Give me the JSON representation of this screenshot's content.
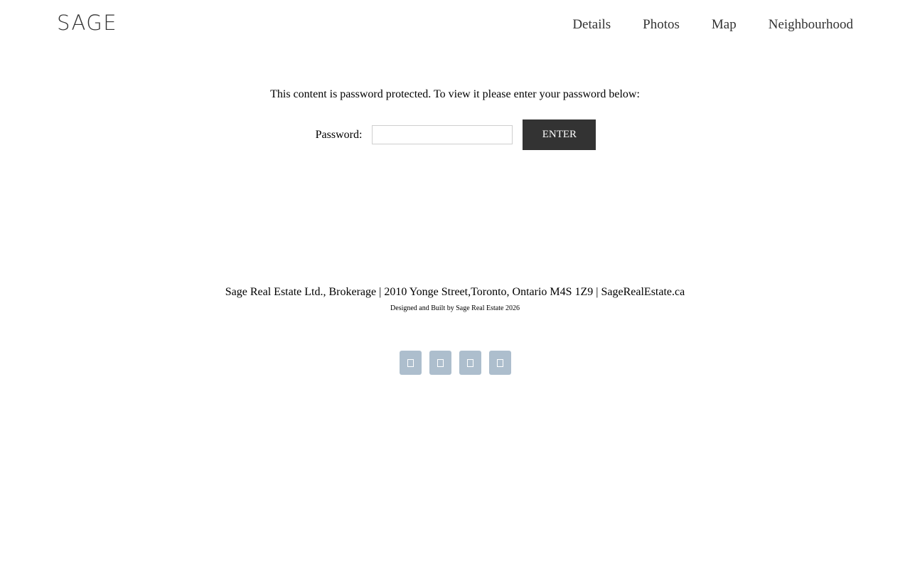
{
  "header": {
    "logo": "SAGE",
    "nav": [
      {
        "label": "Details"
      },
      {
        "label": "Photos"
      },
      {
        "label": "Map"
      },
      {
        "label": "Neighbourhood"
      }
    ]
  },
  "protected": {
    "message": "This content is password protected. To view it please enter your password below:",
    "password_label": "Password:",
    "password_value": "",
    "enter_label": "ENTER"
  },
  "footer": {
    "address": "Sage Real Estate Ltd., Brokerage | 2010 Yonge Street,Toronto, Ontario M4S 1Z9 | SageRealEstate.ca",
    "credit": "Designed and Built by Sage Real Estate 2026",
    "social": [
      {
        "icon": "social-icon-1"
      },
      {
        "icon": "social-icon-2"
      },
      {
        "icon": "social-icon-3"
      },
      {
        "icon": "social-icon-4"
      }
    ]
  },
  "colors": {
    "text": "#333333",
    "button_bg": "#333333",
    "social_bg": "#adbecd"
  }
}
